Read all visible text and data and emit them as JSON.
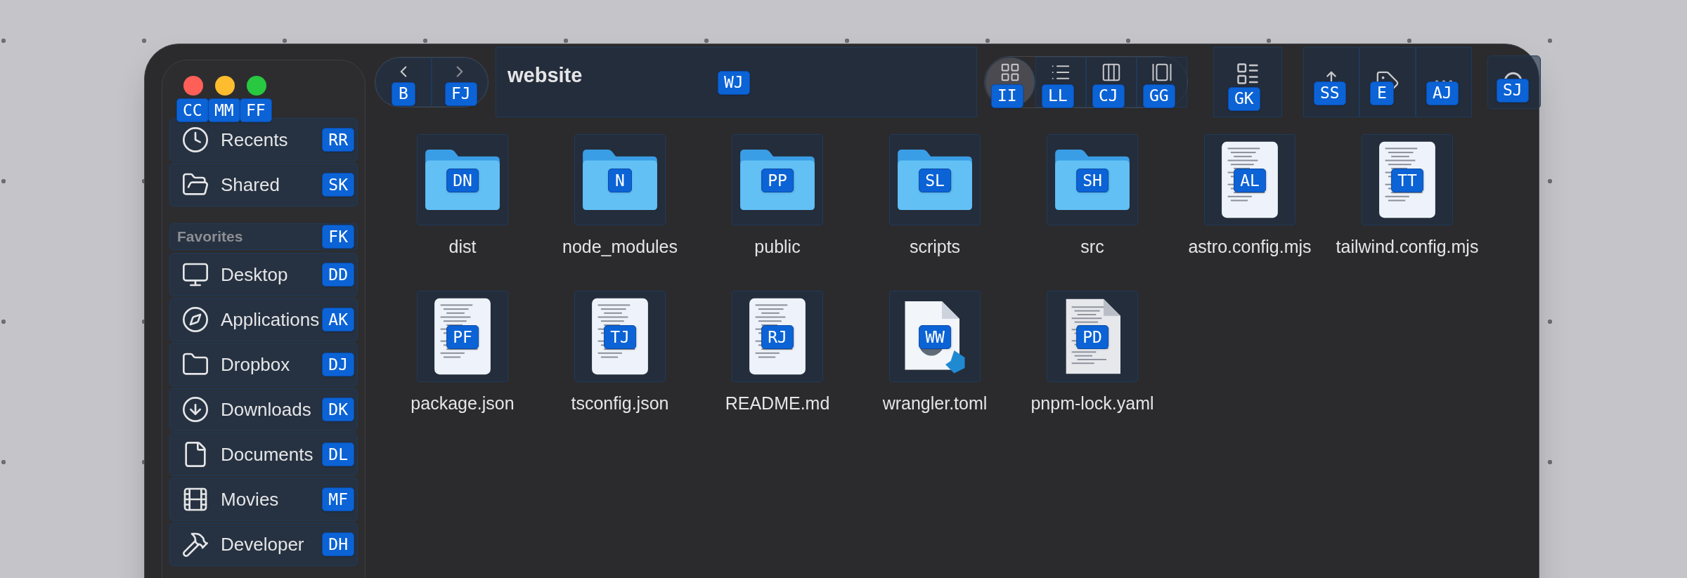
{
  "traffic_lights": [
    {
      "color": "#ff5f57",
      "hint": "CC"
    },
    {
      "color": "#febc2e",
      "hint": "MM"
    },
    {
      "color": "#28c840",
      "hint": "FF"
    }
  ],
  "sidebar": {
    "top_items": [
      {
        "label": "Recents",
        "kind": "clock",
        "hint": "RR"
      },
      {
        "label": "Shared",
        "kind": "shared",
        "hint": "SK"
      }
    ],
    "section": {
      "title": "Favorites",
      "hint": "FK"
    },
    "items": [
      {
        "label": "Desktop",
        "kind": "desktop",
        "hint": "DD"
      },
      {
        "label": "Applications",
        "kind": "apps",
        "hint": "AK"
      },
      {
        "label": "Dropbox",
        "kind": "folder",
        "hint": "DJ"
      },
      {
        "label": "Downloads",
        "kind": "download",
        "hint": "DK"
      },
      {
        "label": "Documents",
        "kind": "document",
        "hint": "DL"
      },
      {
        "label": "Movies",
        "kind": "film",
        "hint": "MF"
      },
      {
        "label": "Developer",
        "kind": "hammer",
        "hint": "DH"
      }
    ]
  },
  "toolbar": {
    "back": {
      "hint": "B"
    },
    "forward": {
      "hint": "FJ"
    },
    "title": "website",
    "title_hint": "WJ",
    "views": [
      {
        "kind": "icons",
        "hint": "II",
        "selected": true
      },
      {
        "kind": "list",
        "hint": "LL",
        "selected": false
      },
      {
        "kind": "columns",
        "hint": "CJ",
        "selected": false
      },
      {
        "kind": "gallery",
        "hint": "GG",
        "selected": false
      }
    ],
    "group": {
      "hint": "GK"
    },
    "actions": [
      {
        "kind": "share",
        "hint": "SS"
      },
      {
        "kind": "tag",
        "hint": "E"
      },
      {
        "kind": "more",
        "hint": "AJ"
      }
    ],
    "search": {
      "hint": "SJ"
    }
  },
  "files": [
    {
      "name": "dist",
      "kind": "folder",
      "hint": "DN"
    },
    {
      "name": "node_modules",
      "kind": "folder",
      "hint": "N"
    },
    {
      "name": "public",
      "kind": "folder",
      "hint": "PP"
    },
    {
      "name": "scripts",
      "kind": "folder",
      "hint": "SL"
    },
    {
      "name": "src",
      "kind": "folder",
      "hint": "SH"
    },
    {
      "name": "astro.config.mjs",
      "kind": "code",
      "hint": "AL"
    },
    {
      "name": "tailwind.config.mjs",
      "kind": "code",
      "hint": "TT"
    },
    {
      "name": "package.json",
      "kind": "code",
      "hint": "PF"
    },
    {
      "name": "tsconfig.json",
      "kind": "code",
      "hint": "TJ"
    },
    {
      "name": "README.md",
      "kind": "code",
      "hint": "RJ"
    },
    {
      "name": "wrangler.toml",
      "kind": "toml",
      "hint": "WW"
    },
    {
      "name": "pnpm-lock.yaml",
      "kind": "text",
      "hint": "PD"
    }
  ]
}
